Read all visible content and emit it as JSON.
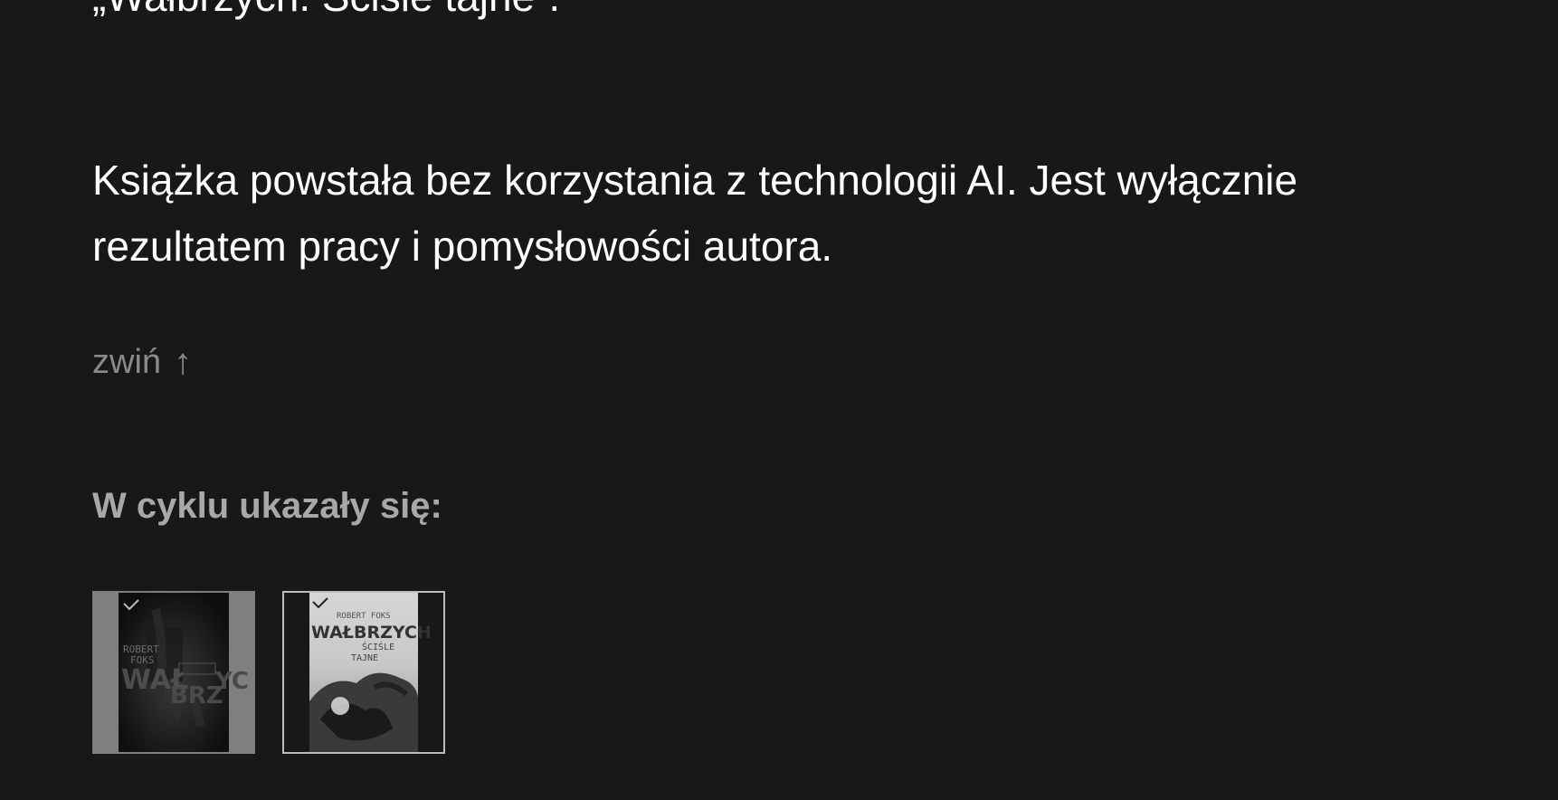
{
  "description": {
    "previous_line": "„Wałbrzych. Ściśle tajne”.",
    "paragraph": "Książka powstała bez korzystania z technologii AI. Jest wyłącznie rezultatem pracy i pomysłowości autora.",
    "collapse_label": "zwiń",
    "collapse_icon": "arrow-up-icon",
    "collapse_arrow": "↑"
  },
  "series": {
    "heading": "W cyklu ukazały się:",
    "books": [
      {
        "author_on_cover": "ROBERT FOKS",
        "title_on_cover": "WAŁBRZYCH",
        "selected": false
      },
      {
        "author_on_cover": "ROBERT FOKS",
        "title_on_cover": "WAŁBRZYCH",
        "subtitle_on_cover": "ŚCIŚLE TAJNE",
        "selected": true
      }
    ]
  },
  "colors": {
    "background": "#181818",
    "text_primary": "#ffffff",
    "text_muted": "#8a8a8a",
    "heading_muted": "#a8a8a8",
    "selected_border": "#bdbdbd"
  }
}
